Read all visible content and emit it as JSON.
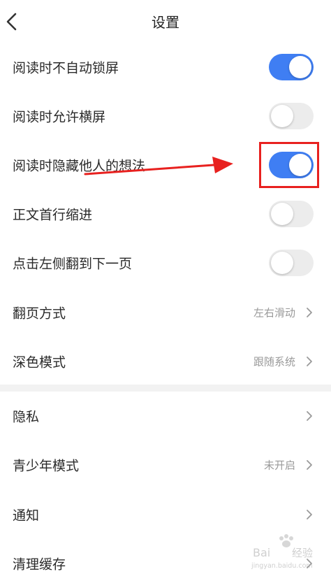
{
  "header": {
    "title": "设置"
  },
  "toggle_rows": [
    {
      "label": "阅读时不自动锁屏",
      "on": true
    },
    {
      "label": "阅读时允许横屏",
      "on": false
    },
    {
      "label": "阅读时隐藏他人的想法",
      "on": true
    },
    {
      "label": "正文首行缩进",
      "on": false
    },
    {
      "label": "点击左侧翻到下一页",
      "on": false
    }
  ],
  "nav_rows_1": [
    {
      "label": "翻页方式",
      "value": "左右滑动"
    },
    {
      "label": "深色模式",
      "value": "跟随系统"
    }
  ],
  "nav_rows_2": [
    {
      "label": "隐私",
      "value": ""
    },
    {
      "label": "青少年模式",
      "value": "未开启"
    },
    {
      "label": "通知",
      "value": ""
    },
    {
      "label": "清理缓存",
      "value": ""
    }
  ],
  "colors": {
    "toggle_on": "#3f7ef3",
    "toggle_off": "#ececec",
    "annotation": "#e8211f"
  },
  "icons": {
    "back": "chevron-left",
    "row_arrow": "chevron-right"
  },
  "watermark": {
    "brand": "Baidu经验",
    "url": "jingyan.baidu.com"
  }
}
